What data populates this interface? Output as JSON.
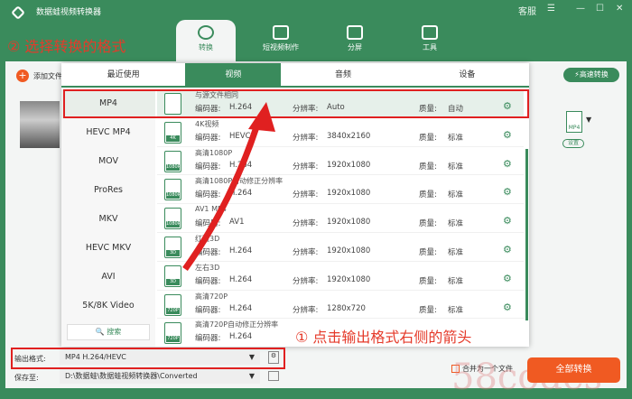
{
  "app": {
    "title": "数据蛙视频转换器",
    "support": "客服"
  },
  "nav": [
    {
      "label": "转换"
    },
    {
      "label": "短视频制作"
    },
    {
      "label": "分屏"
    },
    {
      "label": "工具"
    }
  ],
  "toolbar": {
    "add_file": "添加文件",
    "fast_convert": "高速转换",
    "format_badge": "MP4",
    "settings": "设置"
  },
  "popup": {
    "tabs": [
      "最近使用",
      "视频",
      "音频",
      "设备"
    ],
    "categories": [
      "MP4",
      "HEVC MP4",
      "MOV",
      "ProRes",
      "MKV",
      "HEVC MKV",
      "AVI",
      "5K/8K Video"
    ],
    "search": "搜索",
    "encoder_label": "编码器:",
    "resolution_label": "分辨率:",
    "quality_label": "质量:",
    "presets": [
      {
        "name": "与源文件相同",
        "badge": "",
        "encoder": "H.264",
        "resolution": "Auto",
        "quality": "自动"
      },
      {
        "name": "4K视频",
        "badge": "4K",
        "encoder": "HEVC",
        "resolution": "3840x2160",
        "quality": "标准"
      },
      {
        "name": "高清1080P",
        "badge": "1080P",
        "encoder": "H.264",
        "resolution": "1920x1080",
        "quality": "标准"
      },
      {
        "name": "高清1080P自动修正分辨率",
        "badge": "1080P",
        "encoder": "H.264",
        "resolution": "1920x1080",
        "quality": "标准"
      },
      {
        "name": "AV1 MP4",
        "badge": "1080P",
        "encoder": "AV1",
        "resolution": "1920x1080",
        "quality": "标准"
      },
      {
        "name": "红蓝3D",
        "badge": "3D",
        "encoder": "H.264",
        "resolution": "1920x1080",
        "quality": "标准"
      },
      {
        "name": "左右3D",
        "badge": "3D",
        "encoder": "H.264",
        "resolution": "1920x1080",
        "quality": "标准"
      },
      {
        "name": "高清720P",
        "badge": "720P",
        "encoder": "H.264",
        "resolution": "1280x720",
        "quality": "标准"
      },
      {
        "name": "高清720P自动修正分辨率",
        "badge": "720P",
        "encoder": "H.264",
        "resolution": "",
        "quality": ""
      }
    ]
  },
  "bottom": {
    "output_label": "输出格式:",
    "output_value": "MP4 H.264/HEVC",
    "save_label": "保存至:",
    "save_value": "D:\\数据蛙\\数据蛙视频转换器\\Converted",
    "merge": "合并为一个文件",
    "convert_all": "全部转换"
  },
  "annotations": {
    "step1": "① 点击输出格式右侧的箭头",
    "step2": "② 选择转换的格式"
  },
  "watermark": "58codes"
}
